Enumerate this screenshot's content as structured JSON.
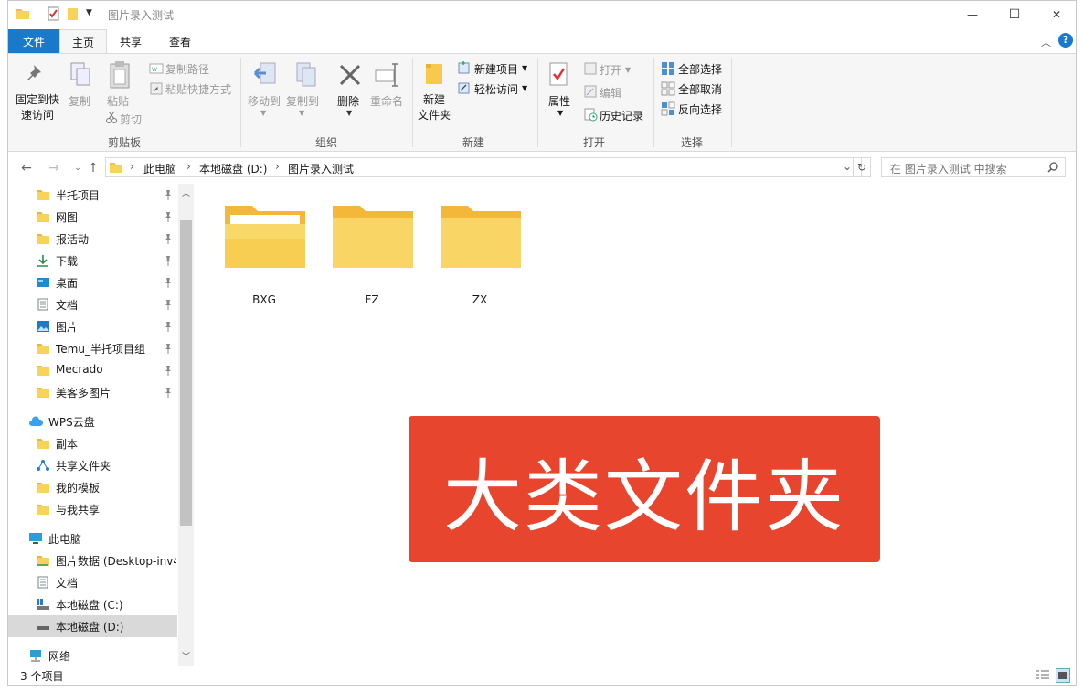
{
  "window": {
    "title": "图片录入测试",
    "minimize_symbol": "—",
    "maximize_symbol": "☐",
    "close_symbol": "✕"
  },
  "ribbon_tabs": [
    {
      "label": "文件"
    },
    {
      "label": "主页"
    },
    {
      "label": "共享"
    },
    {
      "label": "查看"
    }
  ],
  "ribbon": {
    "clipboard": {
      "pin_quick_access": "固定到快速访问",
      "pin_line1": "固定到快",
      "pin_line2": "速访问",
      "copy": "复制",
      "paste": "粘贴",
      "copy_path": "复制路径",
      "paste_shortcut": "粘贴快捷方式",
      "cut": "剪切",
      "group_label": "剪贴板"
    },
    "organize": {
      "move_to": "移动到",
      "copy_to": "复制到",
      "delete": "删除",
      "rename": "重命名",
      "group_label": "组织"
    },
    "new": {
      "new_folder_line1": "新建",
      "new_folder_line2": "文件夹",
      "new_item": "新建项目",
      "easy_access": "轻松访问",
      "group_label": "新建"
    },
    "open": {
      "properties": "属性",
      "open": "打开",
      "edit": "编辑",
      "history": "历史记录",
      "group_label": "打开"
    },
    "select": {
      "select_all": "全部选择",
      "select_none": "全部取消",
      "invert": "反向选择",
      "group_label": "选择"
    }
  },
  "address": {
    "crumbs": [
      "此电脑",
      "本地磁盘 (D:)",
      "图片录入测试"
    ],
    "search_placeholder": "在 图片录入测试 中搜索"
  },
  "sidebar": {
    "quick_access": [
      {
        "label": "半托项目",
        "icon": "folder-icon",
        "pinned": true
      },
      {
        "label": "网图",
        "icon": "folder-icon",
        "pinned": true
      },
      {
        "label": "报活动",
        "icon": "folder-icon",
        "pinned": true
      },
      {
        "label": "下载",
        "icon": "download-icon",
        "pinned": true
      },
      {
        "label": "桌面",
        "icon": "desktop-icon",
        "pinned": true
      },
      {
        "label": "文档",
        "icon": "document-icon",
        "pinned": true
      },
      {
        "label": "图片",
        "icon": "pictures-icon",
        "pinned": true
      },
      {
        "label": "Temu_半托项目组",
        "icon": "folder-icon",
        "pinned": true
      },
      {
        "label": "Mecrado",
        "icon": "folder-icon",
        "pinned": true
      },
      {
        "label": "美客多图片",
        "icon": "folder-icon",
        "pinned": true
      }
    ],
    "wps": {
      "label": "WPS云盘"
    },
    "wps_items": [
      {
        "label": "副本"
      },
      {
        "label": "共享文件夹"
      },
      {
        "label": "我的模板"
      },
      {
        "label": "与我共享"
      }
    ],
    "this_pc": {
      "label": "此电脑"
    },
    "pc_items": [
      {
        "label": "图片数据 (Desktop-inv4"
      },
      {
        "label": "文档"
      },
      {
        "label": "本地磁盘 (C:)"
      },
      {
        "label": "本地磁盘 (D:)"
      }
    ],
    "network": {
      "label": "网络"
    }
  },
  "files": [
    {
      "name": "BXG"
    },
    {
      "name": "FZ"
    },
    {
      "name": "ZX"
    }
  ],
  "banner": {
    "text": "大类文件夹"
  },
  "status": {
    "item_count": "3 个项目"
  },
  "colors": {
    "accent": "#1979ca",
    "banner": "#e8452e",
    "folder": "#f7c94c"
  }
}
